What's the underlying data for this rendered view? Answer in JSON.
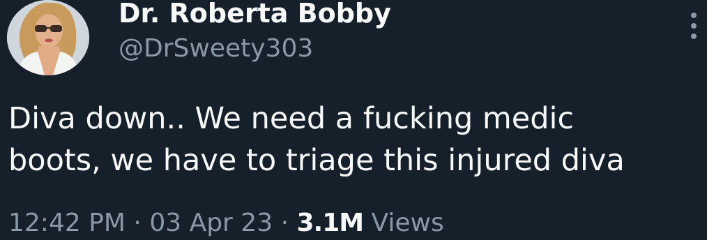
{
  "author": {
    "display_name": "Dr. Roberta Bobby",
    "handle": "@DrSweety303"
  },
  "tweet": {
    "lines": [
      "Diva down.. We need a fucking medic",
      "boots, we have to triage this injured diva"
    ],
    "time": "12:42 PM",
    "date": "03 Apr 23",
    "separator": "·",
    "views_count": "3.1M",
    "views_label": "Views"
  },
  "icons": {
    "more": "more-vertical-icon"
  },
  "colors": {
    "background": "#15202b",
    "primary_text": "#f7f9f9",
    "secondary_text": "#8b98a5"
  }
}
